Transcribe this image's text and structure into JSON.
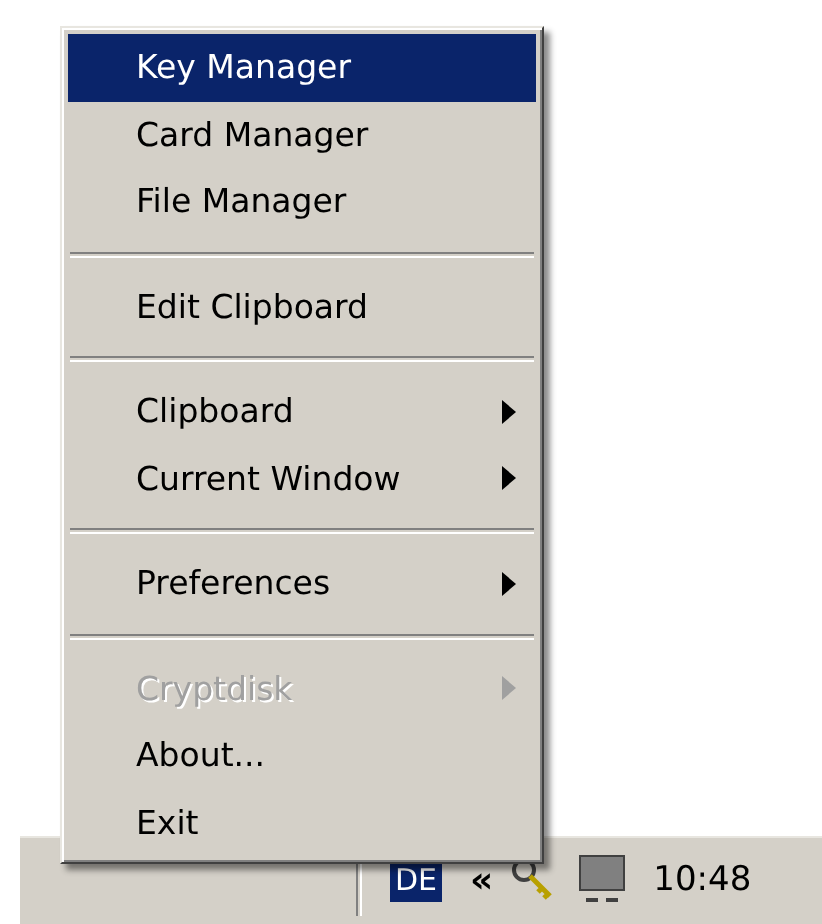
{
  "menu": {
    "items": [
      {
        "kind": "item",
        "label": "Key Manager",
        "selected": true,
        "disabled": false,
        "submenu": false
      },
      {
        "kind": "item",
        "label": "Card Manager",
        "selected": false,
        "disabled": false,
        "submenu": false
      },
      {
        "kind": "item",
        "label": "File Manager",
        "selected": false,
        "disabled": false,
        "submenu": false
      },
      {
        "kind": "separator"
      },
      {
        "kind": "item",
        "label": "Edit Clipboard",
        "selected": false,
        "disabled": false,
        "submenu": false
      },
      {
        "kind": "separator"
      },
      {
        "kind": "item",
        "label": "Clipboard",
        "selected": false,
        "disabled": false,
        "submenu": true
      },
      {
        "kind": "item",
        "label": "Current Window",
        "selected": false,
        "disabled": false,
        "submenu": true
      },
      {
        "kind": "separator"
      },
      {
        "kind": "item",
        "label": "Preferences",
        "selected": false,
        "disabled": false,
        "submenu": true
      },
      {
        "kind": "separator"
      },
      {
        "kind": "item",
        "label": "Cryptdisk",
        "selected": false,
        "disabled": true,
        "submenu": true
      },
      {
        "kind": "item",
        "label": "About...",
        "selected": false,
        "disabled": false,
        "submenu": false
      },
      {
        "kind": "item",
        "label": "Exit",
        "selected": false,
        "disabled": false,
        "submenu": false
      }
    ]
  },
  "taskbar": {
    "language": "DE",
    "chevron": "«",
    "clock": "10:48"
  }
}
